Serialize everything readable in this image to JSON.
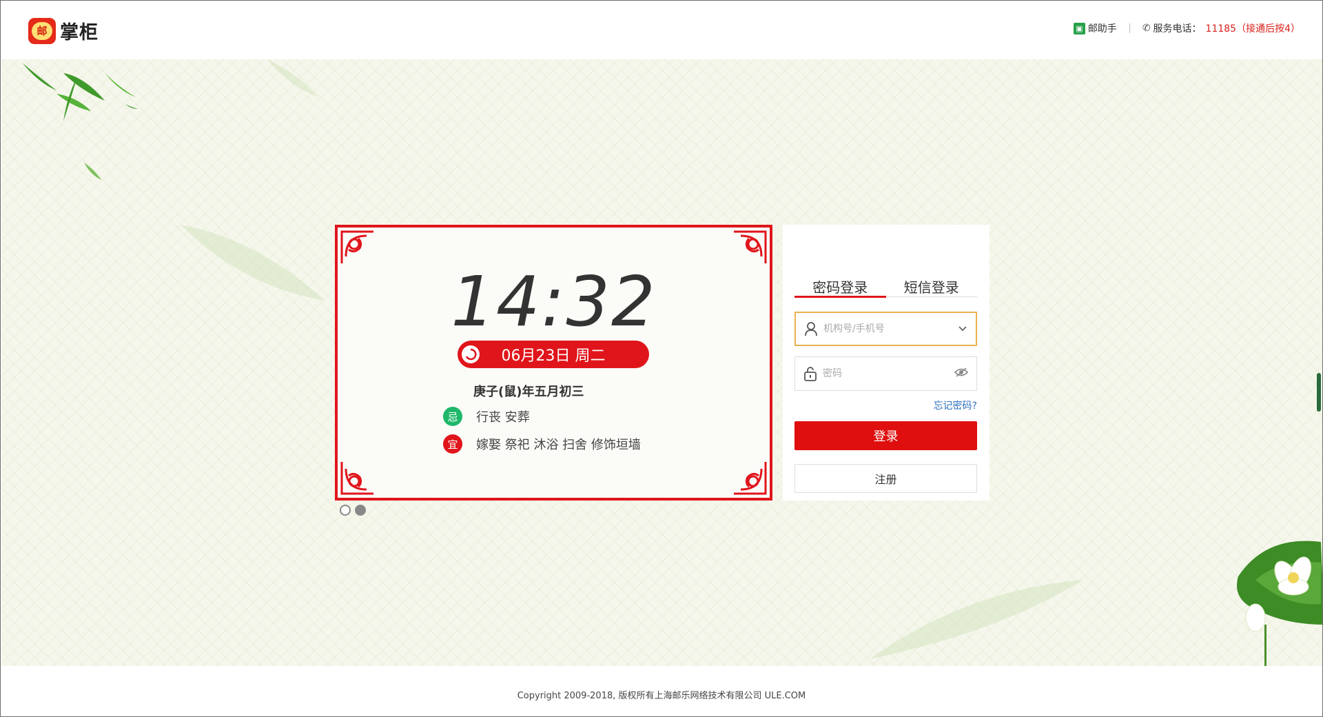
{
  "header": {
    "logo_mark": "邮",
    "logo_text": "掌柜",
    "helper_label": "邮助手",
    "service_label": "服务电话：",
    "service_number": "11185（接通后按4）"
  },
  "calendar": {
    "time": "14:32",
    "date": "06月23日 周二",
    "lunar": "庚子(鼠)年五月初三",
    "avoid_badge": "忌",
    "avoid_text": "行丧 安葬",
    "suit_badge": "宜",
    "suit_text": "嫁娶 祭祀 沐浴 扫舍 修饰垣墙",
    "slides": 2,
    "active_slide": 2
  },
  "login": {
    "tabs": [
      {
        "label": "密码登录",
        "active": true
      },
      {
        "label": "短信登录",
        "active": false
      }
    ],
    "account_placeholder": "机构号/手机号",
    "password_placeholder": "密码",
    "forgot_label": "忘记密码?",
    "login_label": "登录",
    "register_label": "注册"
  },
  "footer": {
    "copyright": "Copyright 2009-2018, 版权所有上海邮乐网络技术有限公司 ULE.COM"
  },
  "colors": {
    "brand_red": "#e0151b",
    "accent_green": "#1fb86a",
    "link_blue": "#2f6fbf",
    "focus_border": "#e8b24f"
  }
}
